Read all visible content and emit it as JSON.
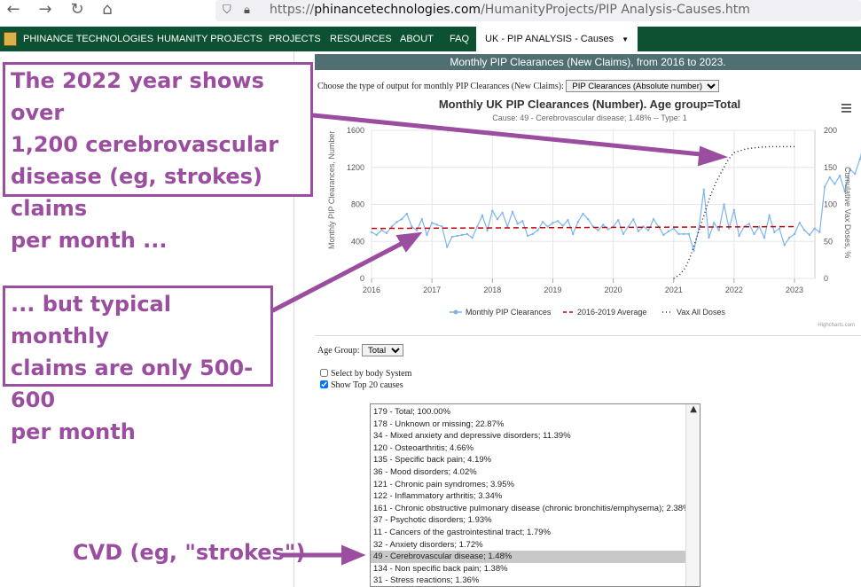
{
  "browser": {
    "back_icon": "arrow-left-icon",
    "forward_icon": "arrow-right-icon",
    "reload_icon": "reload-icon",
    "home_icon": "home-icon",
    "url_scheme": "https://",
    "url_domain": "phinancetechnologies.com",
    "url_path": "/HumanityProjects/PIP Analysis-Causes.htm"
  },
  "nav": {
    "brand": "PHINANCE TECHNOLOGIES",
    "items": [
      "HUMANITY PROJECTS",
      "PROJECTS",
      "RESOURCES",
      "ABOUT",
      "FAQ"
    ],
    "active": "UK - PIP ANALYSIS - Causes",
    "bg_color": "#0c5131"
  },
  "page": {
    "header": "Monthly PIP Clearances (New Claims), from 2016 to 2023.",
    "output_label": "Choose the type of output for monthly PIP Clearances (New Claims):",
    "output_selected": "PIP Clearances (Absolute number)",
    "age_label": "Age Group:",
    "age_selected": "Total",
    "checkbox_body_system": "Select by body System",
    "checkbox_top20": "Show Top 20 causes",
    "body_system_checked": false,
    "top20_checked": true
  },
  "causes": [
    "179 - Total; 100.00%",
    "178 - Unknown or missing; 22.87%",
    "34 - Mixed anxiety and depressive disorders; 11.39%",
    "120 - Osteoarthritis; 4.66%",
    "135 - Specific back pain; 4.19%",
    "36 - Mood disorders; 4.02%",
    "121 - Chronic pain syndromes; 3.95%",
    "122 - Inflammatory arthritis; 3.34%",
    "161 - Chronic obstructive pulmonary disease (chronic bronchitis/emphysema); 2.38%",
    "37 - Psychotic disorders; 1.93%",
    "11 - Cancers of the gastrointestinal tract; 1.79%",
    "32 - Anxiety disorders; 1.72%",
    "49 - Cerebrovascular disease; 1.48%",
    "134 - Non specific back pain; 1.38%",
    "31 - Stress reactions; 1.36%"
  ],
  "selected_cause_index": 12,
  "annotations": {
    "box1": [
      "The 2022 year shows over",
      "1,200 cerebrovascular",
      "disease (eg, strokes) claims",
      "per month ..."
    ],
    "box2": [
      "... but typical monthly",
      "claims are only 500-600",
      "per month"
    ],
    "label3": "CVD (eg, \"strokes\")",
    "color": "#9b4ea0"
  },
  "chart_data": {
    "type": "line",
    "title": "Monthly UK PIP Clearances (Number). Age group=Total",
    "subtitle": "Cause: 49 - Cerebrovascular disease; 1.48% -- Type: 1",
    "ylabel": "Monthly PIP Clearances, Number",
    "ylabel_right": "Cumulative Vax Doses, %",
    "xlim": [
      2016.0,
      2023.1
    ],
    "ylim": [
      0,
      1600
    ],
    "ylim_right": [
      0,
      200
    ],
    "x_ticks": [
      "2016",
      "2017",
      "2018",
      "2019",
      "2020",
      "2021",
      "2022",
      "2023"
    ],
    "y_ticks": [
      "0",
      "400",
      "800",
      "1200",
      "1600"
    ],
    "y_ticks_right": [
      "0",
      "50",
      "100",
      "150",
      "200"
    ],
    "credit": "Highcharts.com",
    "menu_icon": "hamburger-menu-icon",
    "legend_position": "bottom-center",
    "grid": true,
    "series": [
      {
        "name": "Monthly PIP Clearances",
        "color": "#7cb5ec",
        "style": "solid-with-markers",
        "axis": "left",
        "start": 2016.0,
        "step": 0.0833333,
        "values": [
          500,
          470,
          520,
          490,
          560,
          610,
          640,
          700,
          560,
          520,
          640,
          470,
          600,
          580,
          560,
          340,
          450,
          460,
          470,
          480,
          440,
          560,
          680,
          520,
          730,
          640,
          710,
          560,
          720,
          590,
          620,
          460,
          480,
          520,
          610,
          560,
          600,
          620,
          570,
          630,
          480,
          610,
          700,
          640,
          560,
          520,
          580,
          530,
          560,
          630,
          480,
          560,
          640,
          510,
          560,
          520,
          640,
          560,
          470,
          510,
          540,
          480,
          480,
          480,
          300,
          540,
          960,
          440,
          600,
          520,
          800,
          540,
          740,
          460,
          560,
          590,
          480,
          560,
          440,
          680,
          500,
          540,
          360,
          440,
          480,
          600,
          520,
          470,
          540,
          500,
          990,
          1090,
          1020,
          1110,
          940,
          1180,
          1130,
          1290,
          1510,
          1370,
          1380,
          1140,
          1260,
          1350,
          1280,
          1180,
          1360,
          1230,
          1170,
          1380
        ]
      },
      {
        "name": "2016-2019 Average",
        "color": "#cc0000",
        "style": "dashed",
        "axis": "left",
        "values": [
          {
            "x": 2016.0,
            "y": 540
          },
          {
            "x": 2023.0,
            "y": 560
          }
        ]
      },
      {
        "name": "Vax All Doses",
        "color": "#222222",
        "style": "dotted",
        "axis": "right",
        "values": [
          {
            "x": 2021.0,
            "y": 0
          },
          {
            "x": 2021.1,
            "y": 5
          },
          {
            "x": 2021.2,
            "y": 15
          },
          {
            "x": 2021.3,
            "y": 35
          },
          {
            "x": 2021.4,
            "y": 60
          },
          {
            "x": 2021.5,
            "y": 85
          },
          {
            "x": 2021.6,
            "y": 110
          },
          {
            "x": 2021.7,
            "y": 130
          },
          {
            "x": 2021.8,
            "y": 145
          },
          {
            "x": 2021.9,
            "y": 160
          },
          {
            "x": 2022.0,
            "y": 170
          },
          {
            "x": 2022.2,
            "y": 175
          },
          {
            "x": 2022.4,
            "y": 177
          },
          {
            "x": 2022.6,
            "y": 178
          },
          {
            "x": 2022.8,
            "y": 178
          },
          {
            "x": 2023.0,
            "y": 178
          }
        ]
      }
    ]
  }
}
